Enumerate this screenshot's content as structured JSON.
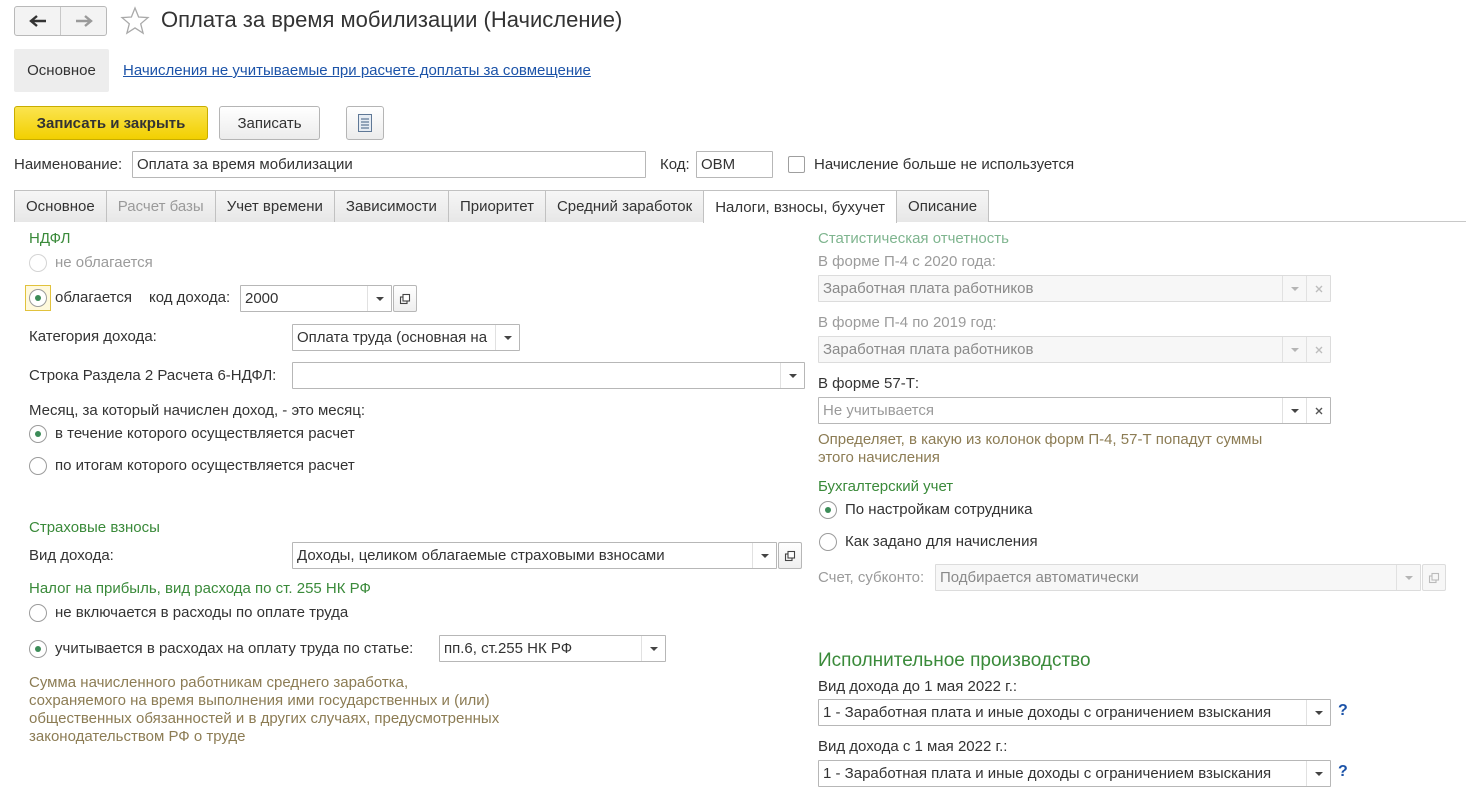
{
  "window": {
    "title": "Оплата за время мобилизации (Начисление)",
    "back_icon": "arrow-left-icon",
    "forward_icon": "arrow-right-icon",
    "favorite_icon": "star-icon"
  },
  "panel": {
    "main_label": "Основное",
    "link_label": "Начисления не учитываемые при расчете доплаты за совмещение"
  },
  "toolbar": {
    "save_close": "Записать и закрыть",
    "save": "Записать",
    "report_icon": "report-list-icon"
  },
  "header": {
    "name_label": "Наименование:",
    "name_value": "Оплата за время мобилизации",
    "code_label": "Код:",
    "code_value": "ОВМ",
    "unused_label": "Начисление больше не используется",
    "unused_checked": false
  },
  "tabs": [
    {
      "label": "Основное",
      "active": false,
      "disabled": false
    },
    {
      "label": "Расчет базы",
      "active": false,
      "disabled": true
    },
    {
      "label": "Учет времени",
      "active": false,
      "disabled": false
    },
    {
      "label": "Зависимости",
      "active": false,
      "disabled": false
    },
    {
      "label": "Приоритет",
      "active": false,
      "disabled": false
    },
    {
      "label": "Средний заработок",
      "active": false,
      "disabled": false
    },
    {
      "label": "Налоги, взносы, бухучет",
      "active": true,
      "disabled": false
    },
    {
      "label": "Описание",
      "active": false,
      "disabled": false
    }
  ],
  "ndfl": {
    "section": "НДФЛ",
    "not_taxed": "не облагается",
    "taxed": "облагается",
    "income_code_label": "код дохода:",
    "income_code_value": "2000",
    "income_category_label": "Категория дохода:",
    "income_category_value": "Оплата труда (основная на",
    "row_label": "Строка Раздела 2 Расчета 6-НДФЛ:",
    "row_value": "",
    "month_label": "Месяц, за который начислен доход, - это месяц:",
    "month_option_1": "в течение которого осуществляется расчет",
    "month_option_2": "по итогам которого осуществляется расчет",
    "selected_tax": "облагается",
    "selected_month": "в течение которого осуществляется расчет"
  },
  "insurance": {
    "section": "Страховые взносы",
    "income_type_label": "Вид дохода:",
    "income_type_value": "Доходы, целиком облагаемые страховыми взносами"
  },
  "profit_tax": {
    "section": "Налог на прибыль, вид расхода по ст. 255 НК РФ",
    "option_1": "не включается в расходы по оплате труда",
    "option_2": "учитывается в расходах на оплату труда по статье:",
    "article_value": "пп.6, ст.255 НК РФ",
    "selected": "учитывается в расходах на оплату труда по статье:",
    "hint": "Сумма начисленного работникам среднего заработка,\nсохраняемого на время выполнения ими государственных и (или)\nобщественных обязанностей и в других случаях, предусмотренных\nзаконодательством РФ о труде"
  },
  "statistics": {
    "section": "Статистическая отчетность",
    "p4_2020_label": "В форме П-4 с 2020 года:",
    "p4_2020_value": "Заработная плата работников",
    "p4_2019_label": "В форме П-4 по 2019 год:",
    "p4_2019_value": "Заработная плата работников",
    "f57t_label": "В форме 57-Т:",
    "f57t_value": "Не учитывается",
    "hint": "Определяет, в какую из колонок форм П-4, 57-Т попадут суммы\nэтого начисления"
  },
  "accounting": {
    "section": "Бухгалтерский учет",
    "option_1": "По настройкам сотрудника",
    "option_2": "Как задано для начисления",
    "selected": "По настройкам сотрудника",
    "account_label": "Счет, субконто:",
    "account_value": "Подбирается автоматически"
  },
  "enforcement": {
    "section": "Исполнительное производство",
    "before_label": "Вид дохода до 1 мая 2022 г.:",
    "before_value": "1 - Заработная плата и иные доходы с ограничением взыскания",
    "after_label": "Вид дохода с 1 мая 2022 г.:",
    "after_value": "1 - Заработная плата и иные доходы с ограничением взыскания",
    "help": "?"
  },
  "colors": {
    "accent_green": "#3a8a3a",
    "link_blue": "#1c53a8",
    "primary_yellow": "#f2d000",
    "hint_brown": "#8c7c54"
  }
}
